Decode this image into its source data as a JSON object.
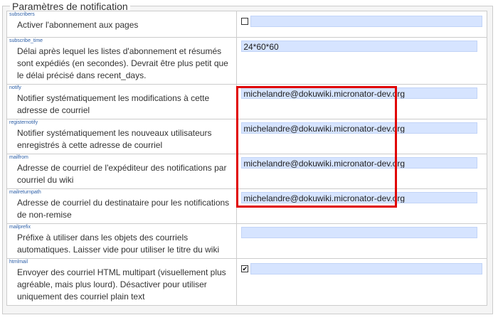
{
  "section": {
    "title": "Paramètres de notification"
  },
  "settings": [
    {
      "key": "subscribers",
      "desc": "Activer l'abonnement aux pages",
      "type": "checkbox",
      "checked": false
    },
    {
      "key": "subscribe_time",
      "desc": "Délai après lequel les listes d'abonnement et résumés sont expédiés (en secondes). Devrait être plus petit que le délai précisé dans recent_days.",
      "type": "text",
      "value": "24*60*60"
    },
    {
      "key": "notify",
      "desc": "Notifier systématiquement les modifications à cette adresse de courriel",
      "type": "text",
      "value": "michelandre@dokuwiki.micronator-dev.org"
    },
    {
      "key": "registernotify",
      "desc": "Notifier systématiquement les nouveaux utilisateurs enregistrés à cette adresse de courriel",
      "type": "text",
      "value": "michelandre@dokuwiki.micronator-dev.org"
    },
    {
      "key": "mailfrom",
      "desc": "Adresse de courriel de l'expéditeur des notifications par courriel du wiki",
      "type": "text",
      "value": "michelandre@dokuwiki.micronator-dev.org"
    },
    {
      "key": "mailreturnpath",
      "desc": "Adresse de courriel du destinataire pour les notifications de non-remise",
      "type": "text",
      "value": "michelandre@dokuwiki.micronator-dev.org"
    },
    {
      "key": "mailprefix",
      "desc": "Préfixe à utiliser dans les objets des courriels automatiques. Laisser vide pour utiliser le titre du wiki",
      "type": "text",
      "value": ""
    },
    {
      "key": "htmlmail",
      "desc": "Envoyer des courriel HTML multipart (visuellement plus agréable, mais plus lourd). Désactiver pour utiliser uniquement des courriel plain text",
      "type": "checkbox",
      "checked": true
    }
  ],
  "colors": {
    "highlight": "#e00000",
    "input_bg": "#d6e4ff",
    "key_text": "#2b5ea7"
  }
}
